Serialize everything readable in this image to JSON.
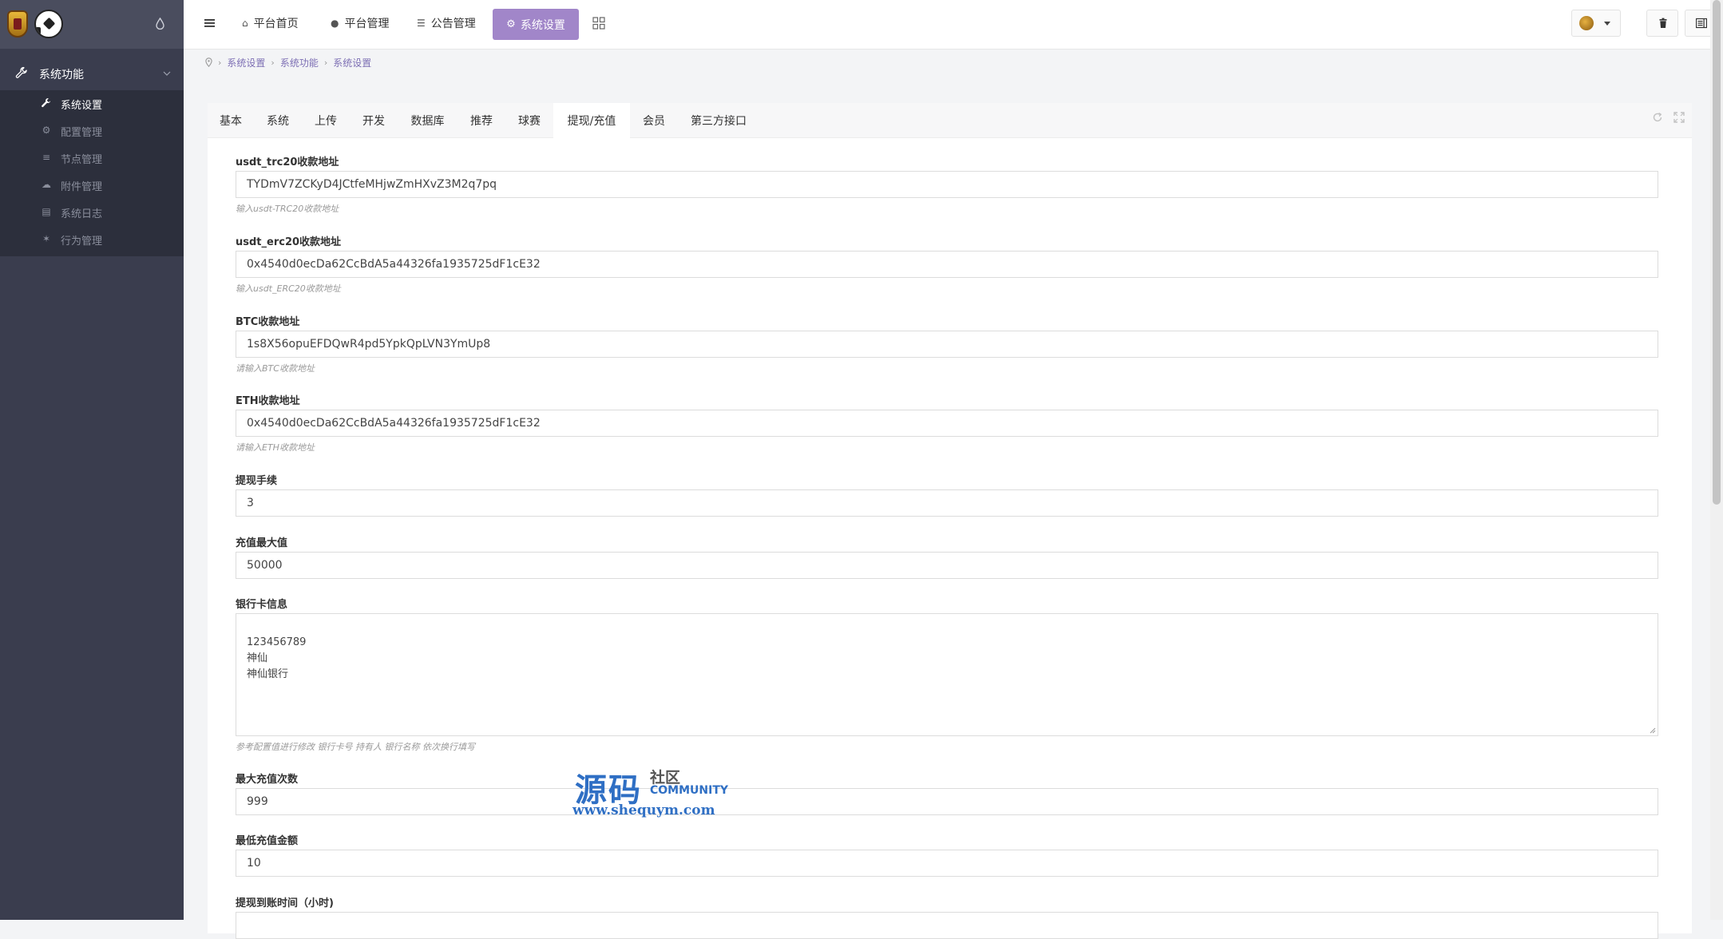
{
  "sidebar": {
    "group_label": "系统功能",
    "items": [
      {
        "label": "系统设置",
        "icon": "wrench-icon",
        "active": true
      },
      {
        "label": "配置管理",
        "icon": "cogs-icon",
        "active": false
      },
      {
        "label": "节点管理",
        "icon": "list-icon",
        "active": false
      },
      {
        "label": "附件管理",
        "icon": "cloud-upload-icon",
        "active": false
      },
      {
        "label": "系统日志",
        "icon": "book-icon",
        "active": false
      },
      {
        "label": "行为管理",
        "icon": "star-icon",
        "active": false
      }
    ]
  },
  "topnav": {
    "items": [
      {
        "label": "平台首页",
        "icon": "home-icon"
      },
      {
        "label": "平台管理",
        "icon": "user-icon"
      },
      {
        "label": "公告管理",
        "icon": "list-alt-icon"
      }
    ],
    "active_label": "系统设置"
  },
  "breadcrumb": [
    "系统设置",
    "系统功能",
    "系统设置"
  ],
  "tabs": [
    {
      "label": "基本",
      "active": false
    },
    {
      "label": "系统",
      "active": false
    },
    {
      "label": "上传",
      "active": false
    },
    {
      "label": "开发",
      "active": false
    },
    {
      "label": "数据库",
      "active": false
    },
    {
      "label": "推荐",
      "active": false
    },
    {
      "label": "球赛",
      "active": false
    },
    {
      "label": "提现/充值",
      "active": true
    },
    {
      "label": "会员",
      "active": false
    },
    {
      "label": "第三方接口",
      "active": false
    }
  ],
  "form": {
    "fields": [
      {
        "label": "usdt_trc20收款地址",
        "value": "TYDmV7ZCKyD4JCtfeMHjwZmHXvZ3M2q7pq",
        "help": "输入usdt-TRC20收款地址"
      },
      {
        "label": "usdt_erc20收款地址",
        "value": "0x4540d0ecDa62CcBdA5a44326fa1935725dF1cE32",
        "help": "输入usdt_ERC20收款地址"
      },
      {
        "label": "BTC收款地址",
        "value": "1s8X56opuEFDQwR4pd5YpkQpLVN3YmUp8",
        "help": "请输入BTC收款地址"
      },
      {
        "label": "ETH收款地址",
        "value": "0x4540d0ecDa62CcBdA5a44326fa1935725dF1cE32",
        "help": "请输入ETH收款地址"
      },
      {
        "label": "提现手续",
        "value": "3"
      },
      {
        "label": "充值最大值",
        "value": "50000"
      },
      {
        "label": "银行卡信息",
        "value": "123456789\n神仙\n神仙银行",
        "help": "参考配置值进行修改 银行卡号 持有人 银行名称 依次换行填写"
      },
      {
        "label": "最大充值次数",
        "value": "999"
      },
      {
        "label": "最低充值金额",
        "value": "10"
      },
      {
        "label": "提现到账时间（小时)"
      }
    ]
  },
  "watermark": {
    "big": "源码",
    "small": "社区",
    "community": "COMMUNITY",
    "url": "www.shequym.com"
  },
  "colors": {
    "sidebar_bg": "#3a3d4e",
    "accent": "#a186c9",
    "link": "#7d6fb4"
  }
}
